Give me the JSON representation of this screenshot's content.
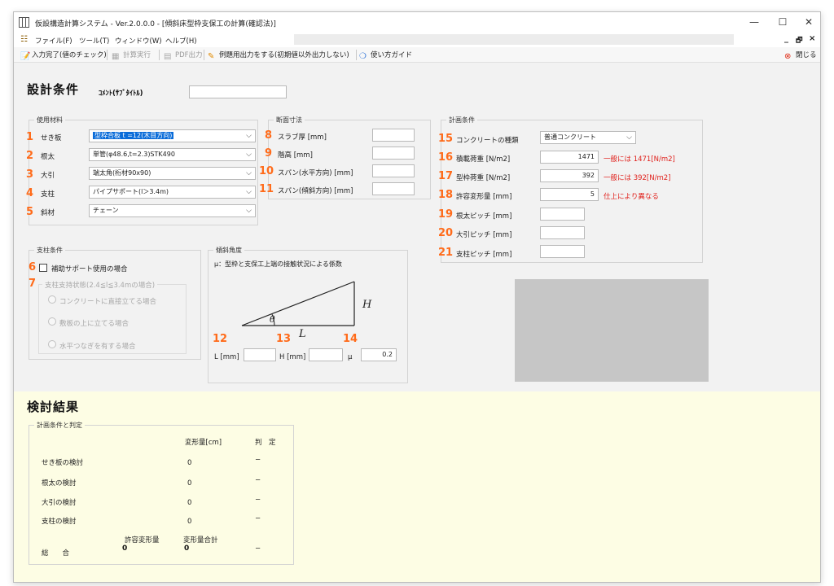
{
  "window": {
    "title": "仮設構造計算システム - Ver.2.0.0.0 - [傾斜床型枠支保工の計算(確認法)]",
    "minimize": "—",
    "maximize": "☐",
    "close": "✕"
  },
  "menu": {
    "items": [
      "ファイル(F)",
      "ツール(T)",
      "ウィンドウ(W)",
      "ヘルプ(H)"
    ],
    "mdi_minimize": "_",
    "mdi_restore": "🗗",
    "mdi_close": "×"
  },
  "toolbar": {
    "input_done": "入力完了(値のチェック)",
    "calc_run": "計算実行",
    "pdf_out": "PDF出力",
    "example_out": "例題用出力をする(初期値以外出力しない)",
    "guide": "使い方ガイド",
    "close": "閉じる"
  },
  "design": {
    "heading": "設計条件",
    "comment_label": "ｺﾒﾝﾄ(ｻﾌﾞﾀｲﾄﾙ)",
    "comment_value": ""
  },
  "materials": {
    "title": "使用材料",
    "rows": [
      {
        "num": "1",
        "label": "せき板",
        "value": "型枠合板 t =12(木目方向)"
      },
      {
        "num": "2",
        "label": "根太",
        "value": "単管(φ48.6,t=2.3)STK490"
      },
      {
        "num": "3",
        "label": "大引",
        "value": "端太角(桁材90x90)"
      },
      {
        "num": "4",
        "label": "支柱",
        "value": "パイプサポート(l＞3.4m)"
      },
      {
        "num": "5",
        "label": "斜材",
        "value": "チェーン"
      }
    ]
  },
  "section": {
    "title": "断面寸法",
    "rows": [
      {
        "num": "8",
        "label": "スラブ厚 [mm]",
        "value": ""
      },
      {
        "num": "9",
        "label": "階高 [mm]",
        "value": ""
      },
      {
        "num": "10",
        "label": "スパン(水平方向)  [mm]",
        "value": ""
      },
      {
        "num": "11",
        "label": "スパン(傾斜方向)  [mm]",
        "value": ""
      }
    ]
  },
  "plan": {
    "title": "計画条件",
    "rows": [
      {
        "num": "15",
        "label": "コンクリートの種類",
        "value": "普通コンクリート",
        "note": ""
      },
      {
        "num": "16",
        "label": "積載荷重  [N/m2]",
        "value": "1471",
        "note": "一般には   1471[N/m2]"
      },
      {
        "num": "17",
        "label": "型枠荷重  [N/m2]",
        "value": "392",
        "note": "一般には   392[N/m2]"
      },
      {
        "num": "18",
        "label": "許容変形量  [mm]",
        "value": "5",
        "note": "仕上により異なる"
      },
      {
        "num": "19",
        "label": "根太ピッチ [mm]",
        "value": "",
        "note": ""
      },
      {
        "num": "20",
        "label": "大引ピッチ [mm]",
        "value": "",
        "note": ""
      },
      {
        "num": "21",
        "label": "支柱ピッチ [mm]",
        "value": "",
        "note": ""
      }
    ]
  },
  "support": {
    "title": "支柱条件",
    "num6": "6",
    "aux_label": "補助サポート使用の場合",
    "num7": "7",
    "state_title": "支柱支持状態(2.4≦l≦3.4mの場合)",
    "options": [
      "コンクリートに直接立てる場合",
      "敷板の上に立てる場合",
      "水平つなぎを有する場合"
    ]
  },
  "slope": {
    "title": "傾斜角度",
    "desc": "μ：型枠と支保工上端の接触状況による係数",
    "label_H": "H",
    "label_L": "L",
    "label_theta": "θ",
    "num12": "12",
    "num13": "13",
    "num14": "14",
    "l_label": "L [mm]",
    "h_label": "H [mm]",
    "mu_label": "μ",
    "l_value": "",
    "h_value": "",
    "mu_value": "0.2"
  },
  "results": {
    "heading": "検討結果",
    "group_title": "計画条件と判定",
    "col_deform": "変形量[cm]",
    "col_judge": "判　定",
    "rows": [
      {
        "label": "せき板の検討",
        "value": "0",
        "judge": "−"
      },
      {
        "label": "根太の検討",
        "value": "0",
        "judge": "−"
      },
      {
        "label": "大引の検討",
        "value": "0",
        "judge": "−"
      },
      {
        "label": "支柱の検討",
        "value": "0",
        "judge": "−"
      }
    ],
    "allow_label": "許容変形量",
    "sum_label": "変形量合計",
    "total_label": "総　　合",
    "allow_value": "0",
    "sum_value": "0",
    "total_judge": "−"
  }
}
